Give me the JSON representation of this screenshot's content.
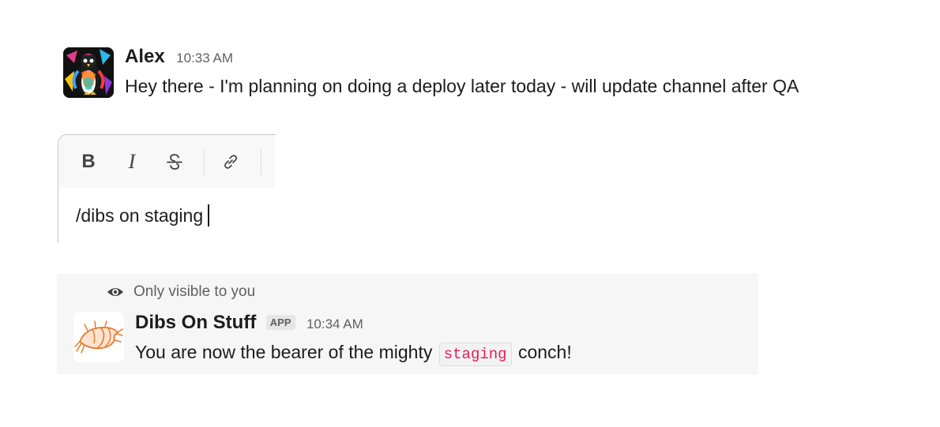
{
  "message_alex": {
    "sender": "Alex",
    "time": "10:33 AM",
    "text": "Hey there - I'm planning on doing a deploy later today - will update channel after QA"
  },
  "composer": {
    "toolbar": {
      "bold": "B",
      "italic": "I",
      "strikethrough_icon": "strikethrough-icon",
      "link_icon": "link-icon"
    },
    "value": "/dibs on staging"
  },
  "ephemeral": {
    "visibility_note": "Only visible to you",
    "eye_icon": "eye-icon",
    "sender": "Dibs On Stuff",
    "badge": "APP",
    "time": "10:34 AM",
    "text_before": "You are now the bearer of the mighty",
    "code": "staging",
    "text_after": "conch!"
  },
  "colors": {
    "code_text": "#e01e5a",
    "muted_text": "#616061",
    "ephemeral_bg": "#f6f6f6",
    "conch_orange": "#e87a2e"
  }
}
